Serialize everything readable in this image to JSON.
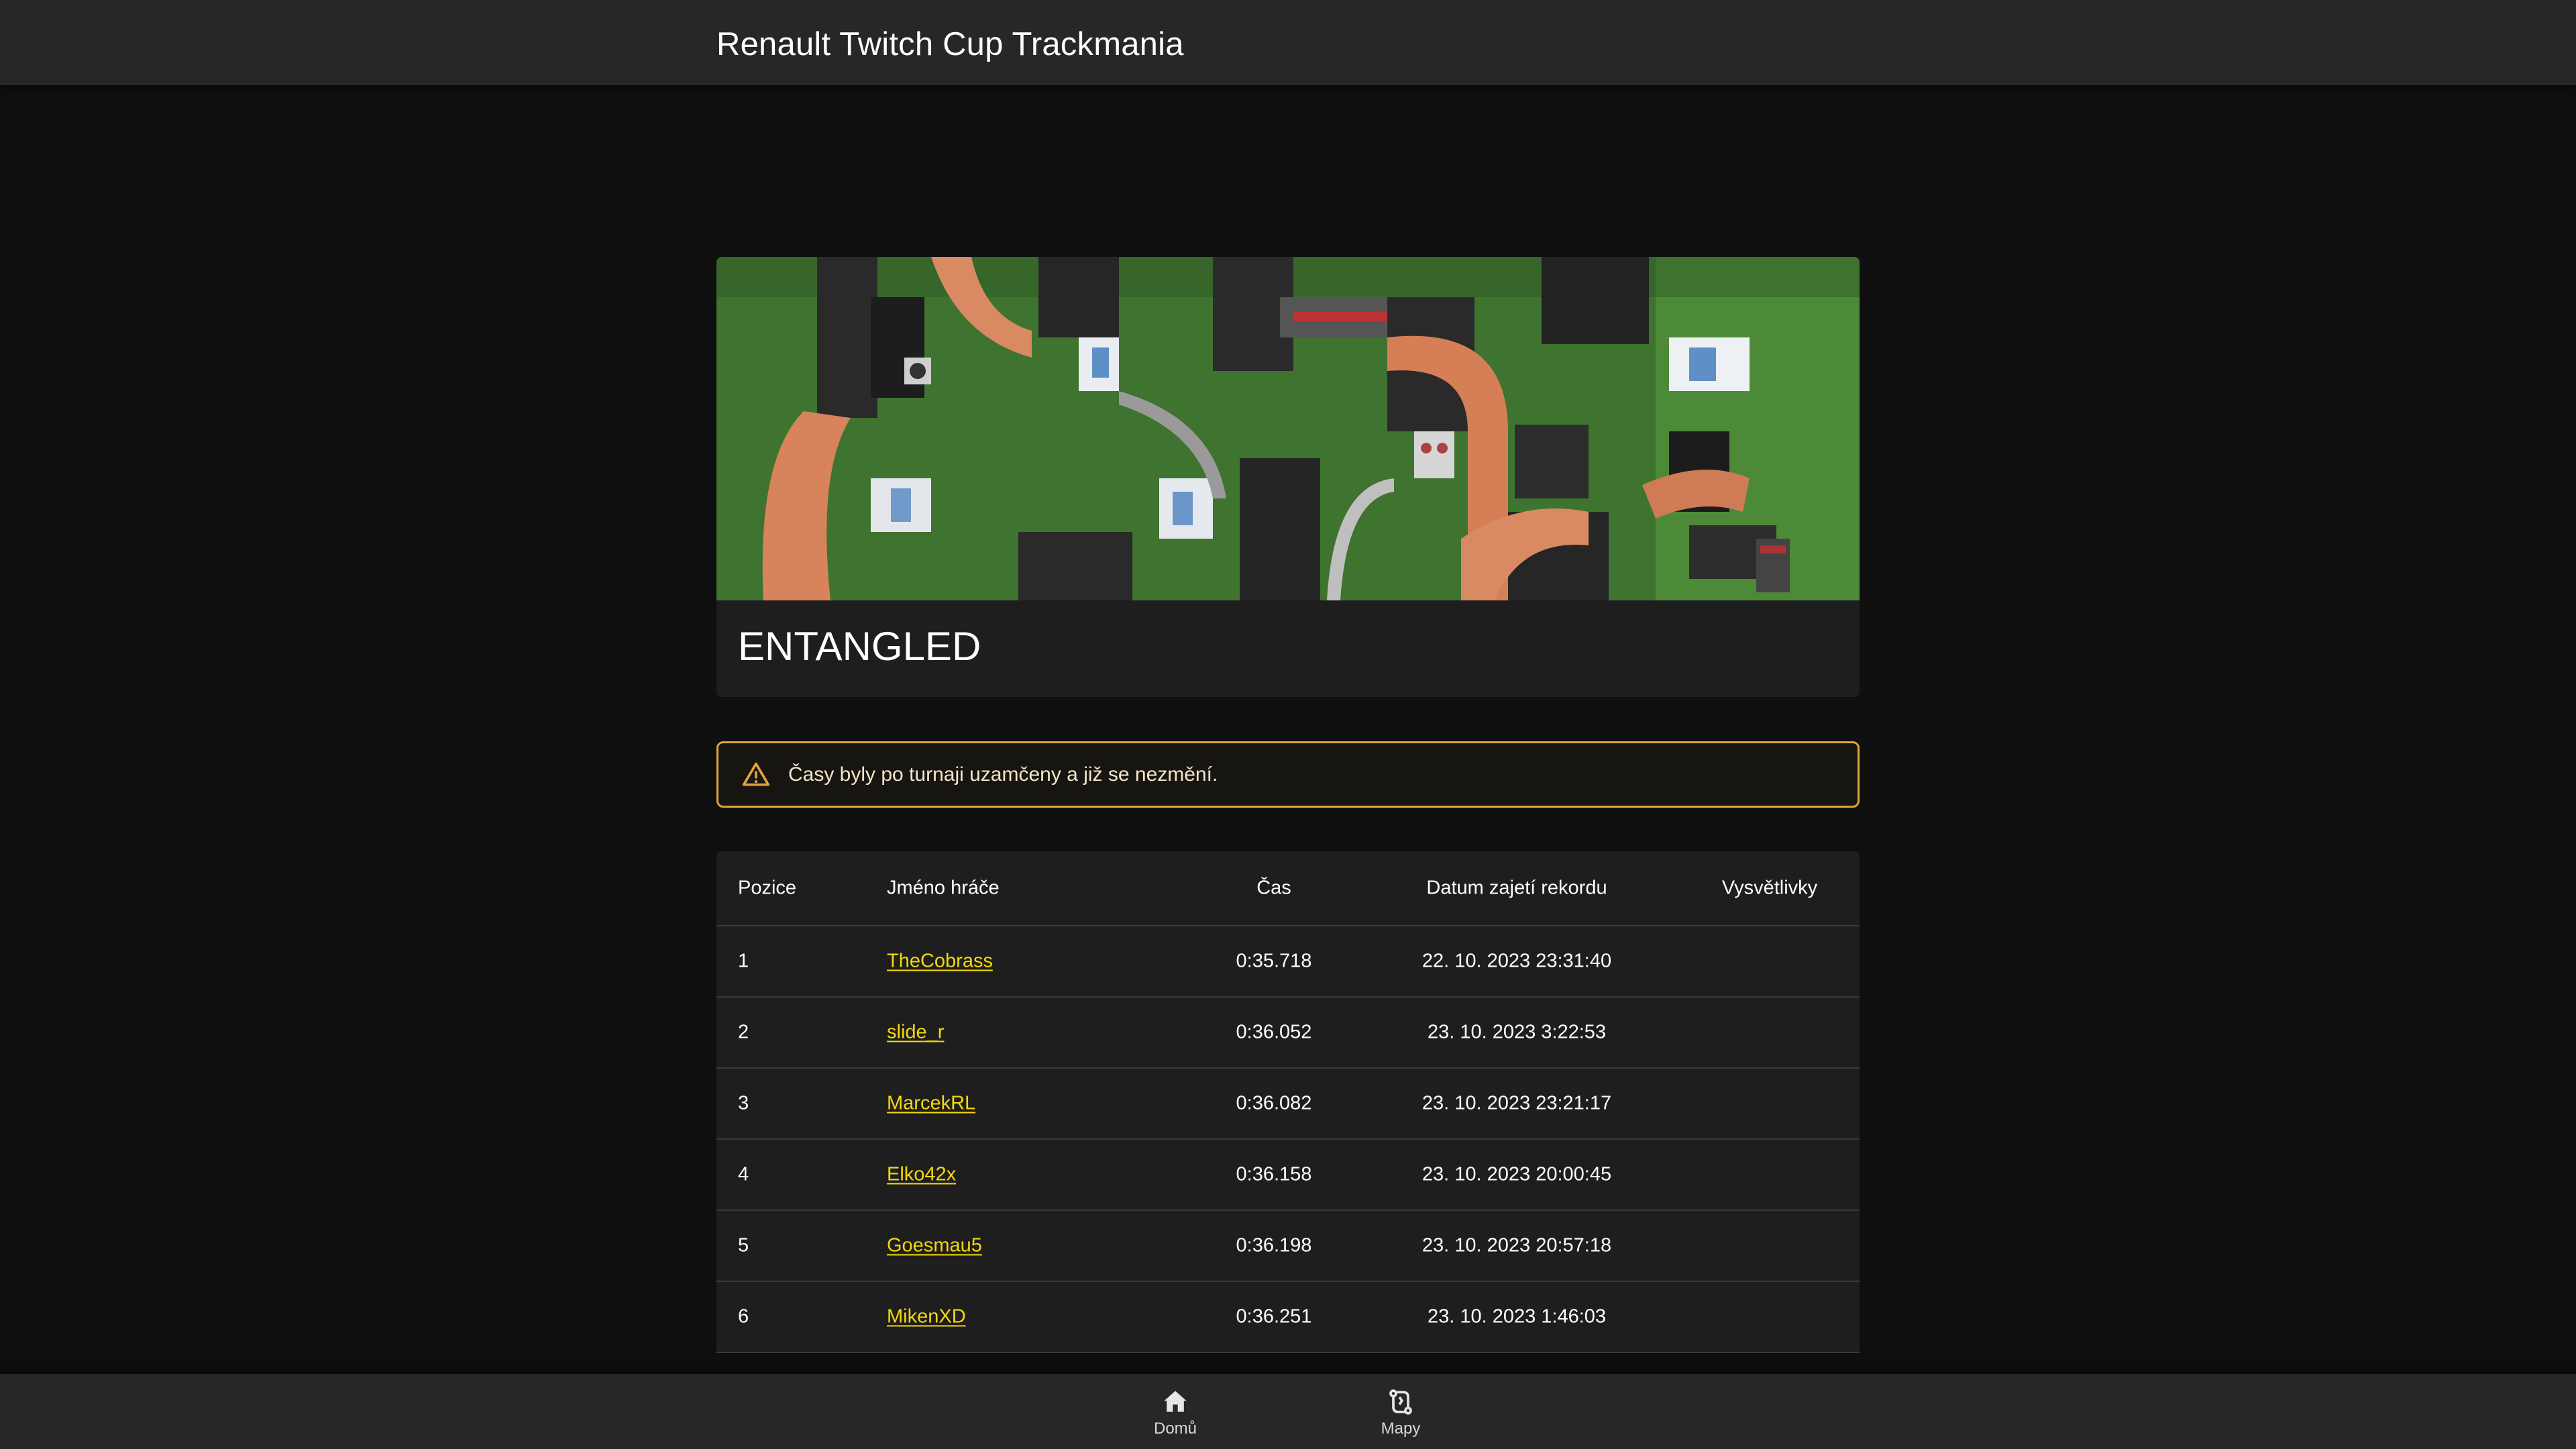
{
  "app": {
    "title": "Renault Twitch Cup Trackmania"
  },
  "map": {
    "name": "ENTANGLED"
  },
  "alert": {
    "text": "Časy byly po turnaji uzamčeny a již se nezmění.",
    "color": "#e0a43a"
  },
  "table": {
    "columns": {
      "position": "Pozice",
      "player": "Jméno hráče",
      "time": "Čas",
      "date": "Datum zajetí rekordu",
      "notes": "Vysvětlivky"
    },
    "rows": [
      {
        "position": "1",
        "player": "TheCobrass",
        "time": "0:35.718",
        "date": "22. 10. 2023 23:31:40",
        "notes": ""
      },
      {
        "position": "2",
        "player": "slide_r",
        "time": "0:36.052",
        "date": "23. 10. 2023 3:22:53",
        "notes": ""
      },
      {
        "position": "3",
        "player": "MarcekRL",
        "time": "0:36.082",
        "date": "23. 10. 2023 23:21:17",
        "notes": ""
      },
      {
        "position": "4",
        "player": "Elko42x",
        "time": "0:36.158",
        "date": "23. 10. 2023 20:00:45",
        "notes": ""
      },
      {
        "position": "5",
        "player": "Goesmau5",
        "time": "0:36.198",
        "date": "23. 10. 2023 20:57:18",
        "notes": ""
      },
      {
        "position": "6",
        "player": "MikenXD",
        "time": "0:36.251",
        "date": "23. 10. 2023 1:46:03",
        "notes": ""
      }
    ]
  },
  "nav": {
    "home": {
      "label": "Domů",
      "icon": "home-icon"
    },
    "maps": {
      "label": "Mapy",
      "icon": "route-icon"
    }
  },
  "colors": {
    "link": "#f5d90a",
    "background": "#0f0f0f",
    "surface": "#1e1e1e",
    "bar": "#272727"
  }
}
